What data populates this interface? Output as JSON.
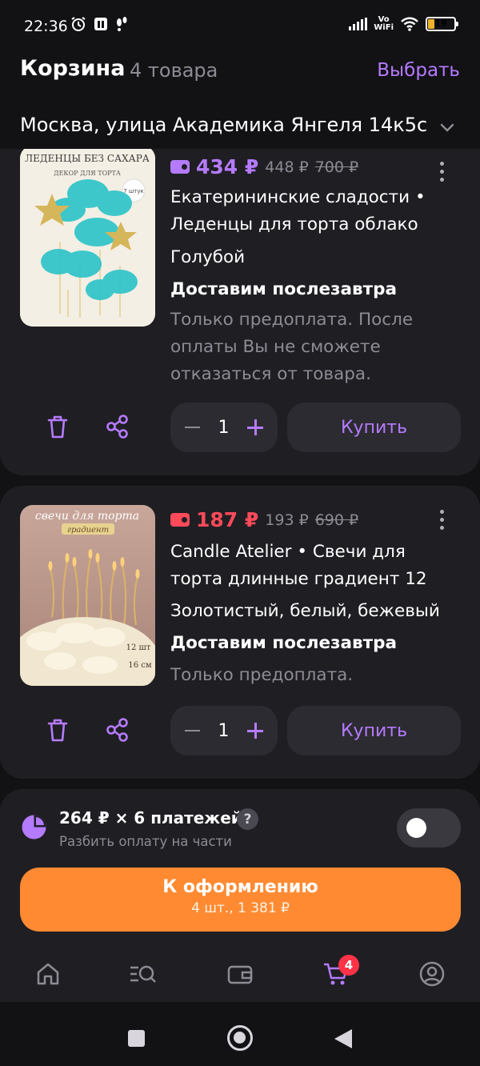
{
  "status": {
    "time": "22:36",
    "vowifi_top": "Vo",
    "vowifi_bottom": "WiFi",
    "battery": "19"
  },
  "header": {
    "title": "Корзина",
    "count": "4 товара",
    "select": "Выбрать"
  },
  "address": "Москва, улица Академика Янгеля 14к5с",
  "items": [
    {
      "thumb_caption_1": "ЛЕДЕНЦЫ БЕЗ САХАРА",
      "thumb_caption_2": "ДЕКОР ДЛЯ ТОРТА",
      "thumb_badge": "7 штук",
      "price": "434 ₽",
      "price_old": "448 ₽",
      "price_strike": "700 ₽",
      "price_color": "#b57bff",
      "title": "Екатерининские сладости • Леденцы для торта облако",
      "variant": "Голубой",
      "delivery": "Доставим послезавтра",
      "note": "Только предоплата. После оплаты Вы не сможете отказаться от товара.",
      "qty": "1",
      "buy": "Купить"
    },
    {
      "thumb_caption_1": "свечи для торта",
      "thumb_caption_2": "градиент",
      "thumb_badge": "12 шт",
      "thumb_badge2": "16 см",
      "price": "187 ₽",
      "price_old": "193 ₽",
      "price_strike": "690 ₽",
      "price_color": "#ff4a5a",
      "title": "Candle Atelier • Свечи для торта длинные градиент 12",
      "variant": "Золотистый, белый, бежевый",
      "delivery": "Доставим послезавтра",
      "note": "Только предоплата.",
      "qty": "1",
      "buy": "Купить"
    }
  ],
  "split": {
    "main": "264 ₽ × 6 платежей",
    "sub": "Разбить оплату на части",
    "help": "?"
  },
  "checkout": {
    "label": "К оформлению",
    "sub": "4 шт., 1 381 ₽"
  },
  "tabbar": {
    "cart_badge": "4"
  },
  "colors": {
    "accent": "#b57bff",
    "orange": "#ff8a32",
    "red": "#ff4a5a",
    "bg": "#121114",
    "card": "#1f1e23"
  }
}
